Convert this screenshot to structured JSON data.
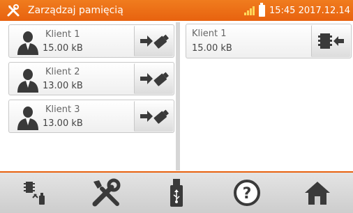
{
  "header": {
    "title": "Zarządzaj pamięcią",
    "time": "15:45 2017.12.14",
    "icons": {
      "menu": "tools-icon",
      "signal": "signal-icon",
      "battery": "battery-icon"
    },
    "accent_color": "#e8620f"
  },
  "clients": [
    {
      "name": "Klient 1",
      "size": "15.00 kB",
      "action_icon": "export-to-usb-icon"
    },
    {
      "name": "Klient 2",
      "size": "13.00 kB",
      "action_icon": "export-to-usb-icon"
    },
    {
      "name": "Klient 3",
      "size": "13.00 kB",
      "action_icon": "export-to-usb-icon"
    }
  ],
  "device_memory": [
    {
      "name": "Klient 1",
      "size": "15.00 kB",
      "action_icon": "import-to-device-icon"
    }
  ],
  "toolbar": {
    "items": [
      {
        "icon": "memory-transfer-icon"
      },
      {
        "icon": "tools-icon"
      },
      {
        "icon": "usb-drive-icon"
      },
      {
        "icon": "help-icon"
      },
      {
        "icon": "home-icon"
      }
    ]
  }
}
